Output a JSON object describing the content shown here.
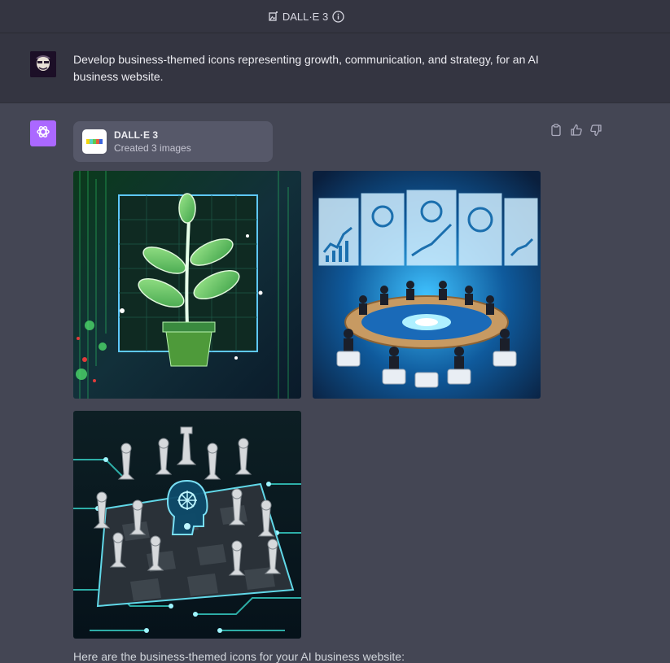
{
  "header": {
    "model_name": "DALL·E 3",
    "icons": [
      "image-edit-icon",
      "info-icon"
    ]
  },
  "user_message": {
    "text": "Develop business-themed icons representing growth, communication, and strategy, for an AI business website."
  },
  "assistant_message": {
    "tool_card": {
      "name": "DALL·E 3",
      "status": "Created 3 images"
    },
    "actions": [
      "copy-icon",
      "thumbs-up-icon",
      "thumbs-down-icon"
    ],
    "images": [
      {
        "subject": "growth-plant-icon"
      },
      {
        "subject": "communication-meeting-icon"
      },
      {
        "subject": "strategy-chess-icon"
      }
    ],
    "reply_text": "Here are the business-themed icons for your AI business website:"
  },
  "colors": {
    "page_bg": "#343541",
    "assistant_bg": "#444654",
    "tool_card_bg": "#565869",
    "gpt_avatar": "#ab68ff",
    "text": "#ececf1"
  }
}
